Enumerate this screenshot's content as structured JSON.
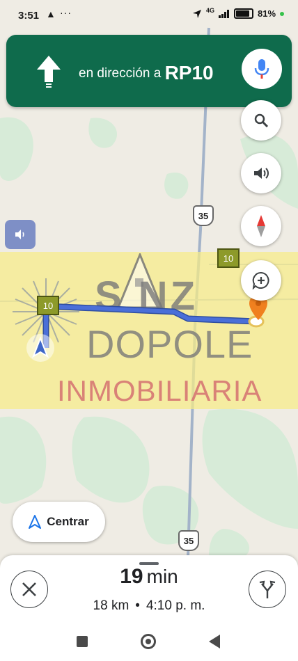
{
  "status_bar": {
    "time": "3:51",
    "nav_glyph": "▲",
    "dots": "···",
    "network": "4G",
    "battery_percent": "81",
    "battery_suffix": "%",
    "battery_level": 0.81
  },
  "navigation_banner": {
    "instruction": "en dirección a",
    "road": "RP10",
    "icons": {
      "direction": "straight-arrow-icon",
      "voice": "microphone-icon"
    }
  },
  "map_controls": {
    "search": "search-icon",
    "sound": "volume-icon",
    "compass": "compass-icon",
    "report": "add-report-icon"
  },
  "map": {
    "road_badges": [
      "35",
      "35"
    ],
    "rp_badges": [
      "10",
      "10"
    ],
    "watermark": {
      "line1": "S NZ",
      "line2": "DOPOLE",
      "line3": "INMOBILIARIA"
    },
    "colors": {
      "route": "#4a6fd8",
      "destination": "#f0801f",
      "watermark_band": "#f6ec87",
      "road": "#a3b3c9"
    }
  },
  "centrar_button": {
    "label": "Centrar"
  },
  "trip": {
    "duration_value": "19",
    "duration_unit": "min",
    "distance": "18 km",
    "separator": "•",
    "arrival": "4:10 p. m."
  },
  "colors": {
    "banner": "#0f6b4c",
    "mic_blue": "#4285f4",
    "mic_red": "#ea4335"
  }
}
